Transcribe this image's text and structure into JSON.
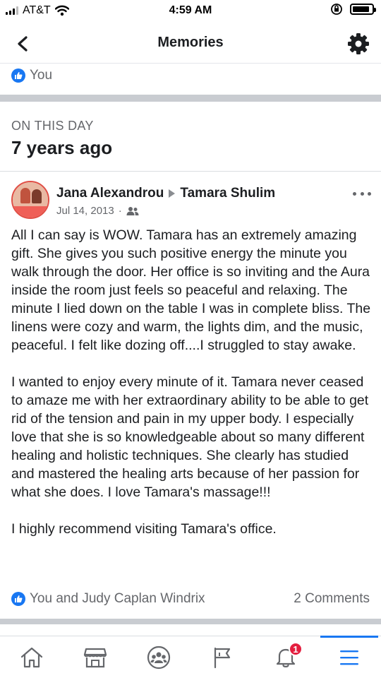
{
  "status_bar": {
    "carrier": "AT&T",
    "time": "4:59 AM",
    "battery_level": 0.9
  },
  "header": {
    "title": "Memories",
    "back_icon": "chevron-left-icon",
    "settings_icon": "gear-icon"
  },
  "previous_post": {
    "reactions_text": "You"
  },
  "on_this_day": {
    "label": "ON THIS DAY",
    "years_ago": "7 years ago"
  },
  "post": {
    "author": "Jana Alexandrou",
    "recipient": "Tamara Shulim",
    "date": "Jul 14, 2013",
    "separator": "·",
    "privacy_icon": "friends-icon",
    "paragraphs": [
      "All I can say is WOW.  Tamara has an extremely amazing gift.  She gives you such positive energy the minute you walk through the door.  Her office is so inviting and the Aura inside the room just feels so peaceful and relaxing. The minute I lied down on the table I was in complete bliss. The linens were cozy and warm, the lights dim, and the music, peaceful. I felt like dozing off....I struggled to stay awake.",
      "I wanted to enjoy every minute of it.   Tamara never ceased to amaze me with her extraordinary ability to be able to get rid of the tension and pain in my upper body. I especially love that she is so knowledgeable about so many different healing and holistic techniques. She clearly has studied and mastered the healing arts because of her passion for what she does. I love Tamara's massage!!!",
      "I highly recommend visiting Tamara's office."
    ],
    "reactions_text": "You and Judy Caplan Windrix",
    "comments_text": "2 Comments"
  },
  "tabbar": {
    "tabs": [
      {
        "icon": "home-icon"
      },
      {
        "icon": "marketplace-icon"
      },
      {
        "icon": "groups-icon"
      },
      {
        "icon": "pages-flag-icon"
      },
      {
        "icon": "notifications-bell-icon",
        "badge": "1"
      },
      {
        "icon": "menu-icon",
        "active": true
      }
    ]
  },
  "colors": {
    "accent": "#1877f2",
    "badge": "#e41e3f",
    "secondary_text": "#65676b",
    "separator": "#c9ccd1"
  }
}
